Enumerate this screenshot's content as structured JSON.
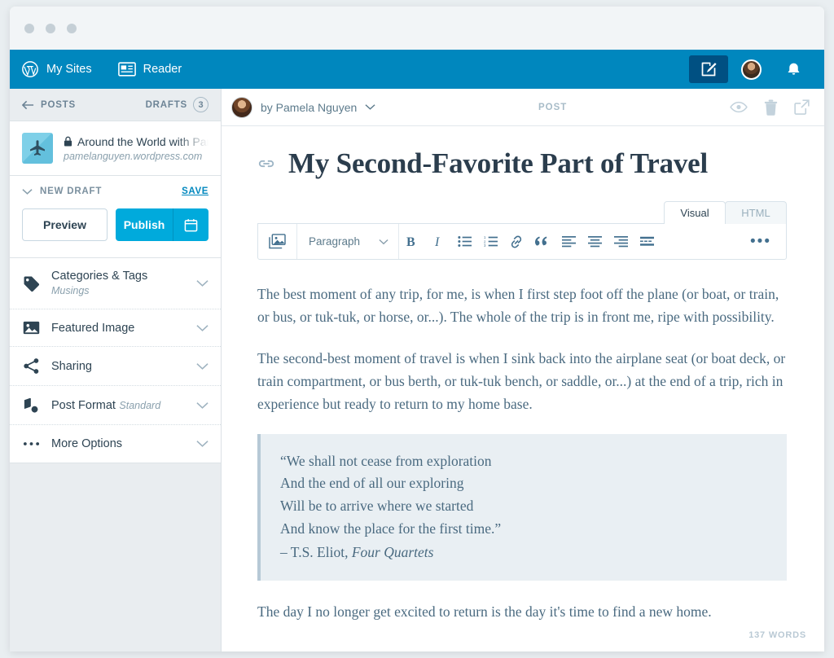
{
  "masterbar": {
    "wordpress_logo": "wordpress-logo-icon",
    "my_sites": "My Sites",
    "reader": "Reader",
    "write_button": "write-icon",
    "notifications": "bell-icon"
  },
  "sidebar": {
    "back_label": "POSTS",
    "drafts_label": "DRAFTS",
    "drafts_count": "3",
    "site": {
      "icon": "airplane-icon",
      "privacy_icon": "lock-icon",
      "title": "Around the World with Pamela",
      "url": "pamelanguyen.wordpress.com"
    },
    "draft_status": "NEW DRAFT",
    "save_label": "SAVE",
    "preview_label": "Preview",
    "publish_label": "Publish",
    "schedule_icon": "calendar-icon",
    "menu": [
      {
        "label": "Categories & Tags",
        "sub": "Musings",
        "icon": "tag-icon"
      },
      {
        "label": "Featured Image",
        "sub": "",
        "icon": "image-icon"
      },
      {
        "label": "Sharing",
        "sub": "",
        "icon": "share-icon"
      },
      {
        "label": "Post Format",
        "sub": "Standard",
        "icon": "post-format-icon"
      },
      {
        "label": "More Options",
        "sub": "",
        "icon": "ellipsis-icon"
      }
    ]
  },
  "editor": {
    "author_label": "by Pamela Nguyen",
    "post_type": "POST",
    "actions": [
      "eye-icon",
      "trash-icon",
      "external-link-icon"
    ],
    "title": "My Second-Favorite Part of Travel",
    "title_link_icon": "link-icon",
    "tabs": [
      {
        "label": "Visual",
        "active": true
      },
      {
        "label": "HTML",
        "active": false
      }
    ],
    "toolbar": {
      "media_icon": "add-media-icon",
      "block_format": "Paragraph",
      "buttons": [
        "bold-icon",
        "italic-icon",
        "bulleted-list-icon",
        "numbered-list-icon",
        "link-icon",
        "blockquote-icon",
        "align-left-icon",
        "align-center-icon",
        "align-right-icon",
        "read-more-icon"
      ],
      "more_label": "•••"
    },
    "paragraphs": [
      "The best moment of any trip, for me, is when I first step foot off the plane (or boat, or train, or bus, or tuk-tuk, or horse, or...). The whole of the trip is in front me, ripe with possibility.",
      "The second-best moment of travel is when I sink back into the airplane seat (or boat deck, or train compartment, or bus berth, or tuk-tuk bench, or saddle, or...) at the end of a trip, rich in experience but ready to return to my home base."
    ],
    "quote": {
      "lines": [
        "“We shall not cease from exploration",
        "And the end of all our exploring",
        "Will be to arrive where we started",
        "And know the place for the first time.”"
      ],
      "cite_prefix": "– T.S. Eliot, ",
      "cite_work": "Four Quartets"
    },
    "closing_paragraph": "The day I no longer get excited to return is the day it's time to find a new home.",
    "word_count": "137 WORDS"
  },
  "colors": {
    "masterbar": "#0087be",
    "masterbar_active": "#005082",
    "publish": "#00aadc",
    "sidebar_bg": "#e9edf0",
    "text_dark": "#2e4453",
    "text_body": "#4a6a80",
    "quote_bg": "#e9eff3"
  }
}
